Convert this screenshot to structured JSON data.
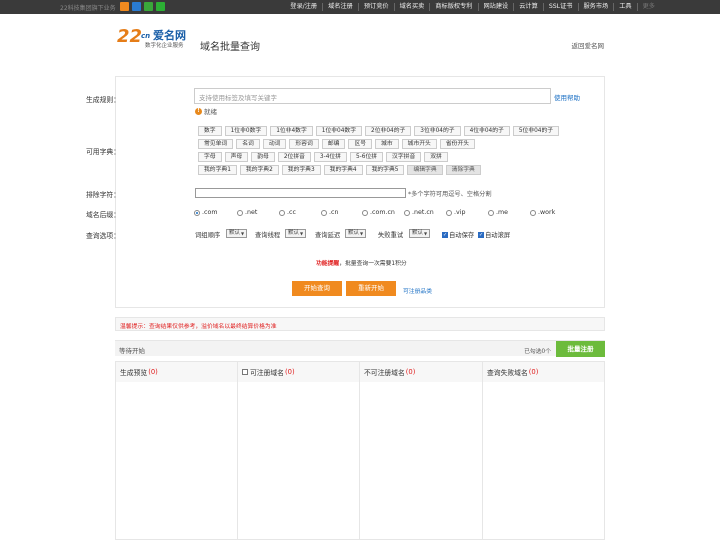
{
  "topbar": {
    "slogan": "22科技集团旗下业务",
    "apps": [
      {
        "icon": "app-icon-orange",
        "color": "#f08a1f"
      },
      {
        "icon": "app-icon-blue",
        "color": "#2a7bd0"
      },
      {
        "icon": "app-icon-green",
        "color": "#3aa83a"
      },
      {
        "icon": "wechat-icon",
        "color": "#2cb034"
      }
    ],
    "nav": [
      "登录/注册",
      "域名注册",
      "预订竞价",
      "域名买卖",
      "商标版权专利",
      "网站建设",
      "云计算",
      "SSL证书",
      "服务市场",
      "工具",
      "更多"
    ]
  },
  "header": {
    "logo_num": "22",
    "logo_cn": "cn",
    "logo_name": "爱名网",
    "logo_sub": "数字化企业服务",
    "page_title": "域名批量查询",
    "back_link": "返回爱名网"
  },
  "form": {
    "rule_label": "生成规则：",
    "rule_placeholder": "支持使用标签及填写关键字",
    "help_link": "使用帮助",
    "status_icon": "!",
    "status_text": "就绪",
    "dict_label": "可用字典：",
    "dict_rows": [
      [
        "数字",
        "1位非0数字",
        "1位非4数字",
        "1位非04数字",
        "2位非04的子",
        "3位非04的子",
        "4位非04的子",
        "5位非04的子"
      ],
      [
        "常见单词",
        "名词",
        "动词",
        "形容词",
        "邮编",
        "区号",
        "城市",
        "城市开头",
        "省份开头"
      ],
      [
        "字母",
        "声母",
        "韵母",
        "2位拼音",
        "3-4位拼",
        "5-6位拼",
        "汉字拼音",
        "双拼"
      ],
      [
        "我的字典1",
        "我的字典2",
        "我的字典3",
        "我的字典4",
        "我的字典5",
        "编辑字典",
        "清除字典"
      ]
    ],
    "exclude_label": "排除字符：",
    "exclude_hint": "*多个字符可用逗号、空格分割",
    "suffix_label": "域名后缀：",
    "suffixes": [
      ".com",
      ".net",
      ".cc",
      ".cn",
      ".com.cn",
      ".net.cn",
      ".vip",
      ".me",
      ".work"
    ],
    "suffix_selected": ".com",
    "options_label": "查询选项：",
    "options": {
      "order_label": "词组顺序",
      "order_value": "默认",
      "threads_label": "查询线程",
      "threads_value": "默认",
      "delay_label": "查询延迟",
      "delay_value": "默认",
      "retry_label": "失败重试",
      "retry_value": "默认",
      "autosave_label": "自动保存",
      "autoscroll_label": "自动滚屏"
    },
    "notice_warn": "功能提醒",
    "notice_text": "，批量查询一次需要1积分",
    "start_button": "开始查询",
    "restart_button": "重新开始",
    "register_link": "可注册品类"
  },
  "tip": "温馨提示：查询结果仅供参考，溢价域名以最终结算价格为准",
  "results": {
    "status": "等待开始",
    "selected_count": "已勾选0个",
    "bulk_button": "批量注册",
    "columns": [
      {
        "title": "生成预览",
        "count": "(0)",
        "checkbox": false
      },
      {
        "title": "可注册域名",
        "count": "(0)",
        "checkbox": true
      },
      {
        "title": "不可注册域名",
        "count": "(0)",
        "checkbox": false
      },
      {
        "title": "查询失败域名",
        "count": "(0)",
        "checkbox": false
      }
    ]
  }
}
